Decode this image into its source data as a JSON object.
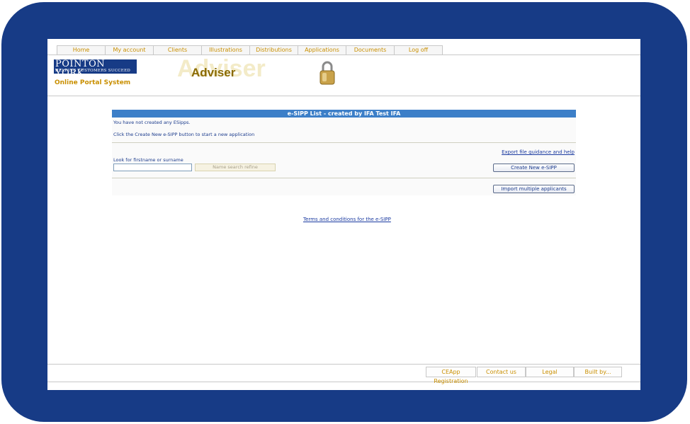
{
  "tabs": [
    "Home",
    "My account",
    "Clients",
    "Illustrations",
    "Distributions",
    "Applications",
    "Documents",
    "Log off"
  ],
  "header": {
    "logo_line1": "POINTON YORK",
    "logo_line2": "HELPING CUSTOMERS SUCCEED",
    "portal_label": "Online Portal System",
    "adviser_ghost": "Adviser",
    "adviser_label": "Adviser",
    "lock_icon": "padlock-icon"
  },
  "main": {
    "title": "e-SIPP List - created by IFA Test IFA",
    "message1": "You have not created any ESipps.",
    "message2": "Click the Create New e-SIPP button to start a new application",
    "export_link": "Export file guidance and help",
    "search_label": "Look for firstname or surname",
    "search_value": "",
    "refine_button": "Name search refine",
    "create_button": "Create New e-SIPP",
    "import_button": "Import multiple applicants",
    "terms_link": "Terms and conditions for the e-SIPP"
  },
  "footer": [
    "CEApp Registration",
    "Contact us",
    "Legal",
    "Built by..."
  ],
  "colors": {
    "frame": "#173b86",
    "accent_gold": "#c98f00",
    "title_bar": "#3c7fc8",
    "link": "#1a3aa0"
  }
}
